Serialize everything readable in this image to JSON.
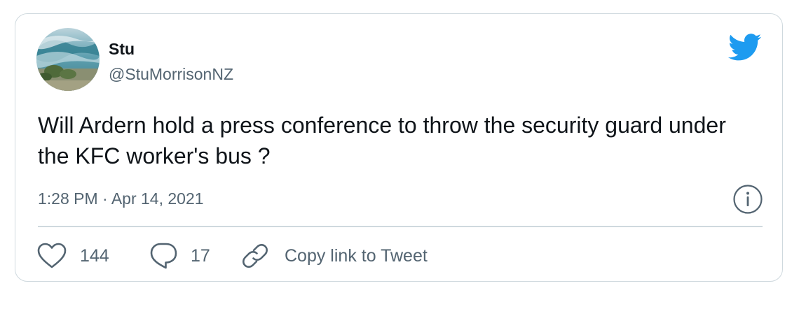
{
  "tweet": {
    "display_name": "Stu",
    "handle": "@StuMorrisonNZ",
    "text": "Will Ardern hold a press conference to throw the security guard under the KFC worker's bus ?",
    "timestamp": "1:28 PM · Apr 14, 2021"
  },
  "actions": {
    "likes": "144",
    "replies": "17",
    "copy_link": "Copy link to Tweet"
  },
  "icons": {
    "brand": "twitter-bird-icon",
    "info": "info-icon",
    "like": "heart-icon",
    "reply": "speech-bubble-icon",
    "copy": "link-icon"
  },
  "colors": {
    "brand": "#1d9bf0",
    "text": "#0f1419",
    "secondary": "#536471",
    "border": "#cfd9de"
  }
}
